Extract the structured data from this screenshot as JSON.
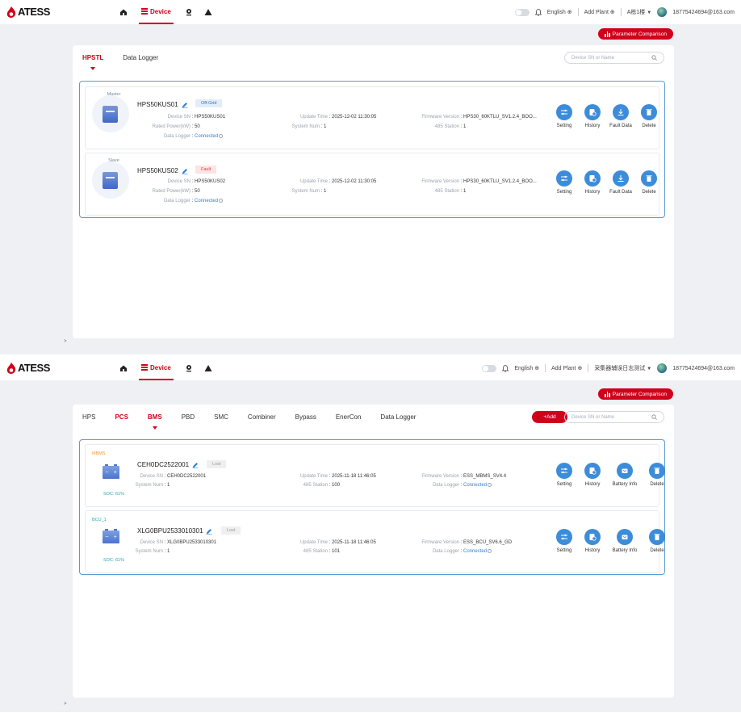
{
  "brand": {
    "logo_text": "ATESS",
    "accent": "#d0021b",
    "link": "#2f7fd6",
    "action": "#3c8cd9"
  },
  "screens": [
    {
      "nav": {
        "device_label": "Device",
        "icons": [
          "home-icon",
          "device-list-icon",
          "location-icon",
          "warning-icon"
        ]
      },
      "header": {
        "language": "English",
        "add_plant": "Add Plant",
        "plant": "A栋1楼",
        "user": "18775424694@163.com"
      },
      "param_button": "Parameter Comparison",
      "tabs": [
        {
          "label": "HPSTL",
          "active": true,
          "red": true
        },
        {
          "label": "Data Logger",
          "active": false,
          "red": false
        }
      ],
      "search_placeholder": "Device SN or Name",
      "devices": [
        {
          "role": "Master",
          "name": "HPS50KUS01",
          "status": "Off-Grid",
          "status_type": "offgrid",
          "rows": [
            {
              "k": "Device SN",
              "v": "HPS50KUS01"
            },
            {
              "k": "Rated Power(kW)",
              "v": "50"
            },
            {
              "k": "Data Logger",
              "v": "Connected",
              "link": true,
              "info": true
            }
          ],
          "mid": [
            {
              "k": "Update Time",
              "v": "2025-12-02 11:30:05"
            },
            {
              "k": "System Num",
              "v": "1"
            }
          ],
          "right": [
            {
              "k": "Firmware Version",
              "v": "HPS30_60KTLU_SV1.2.4_BOO..."
            },
            {
              "k": "485 Station",
              "v": "1"
            }
          ],
          "actions": [
            {
              "label": "Setting",
              "icon": "sliders-icon"
            },
            {
              "label": "History",
              "icon": "history-icon"
            },
            {
              "label": "Fault Data",
              "icon": "download-icon"
            },
            {
              "label": "Delete",
              "icon": "trash-icon"
            }
          ]
        },
        {
          "role": "Slave",
          "name": "HPS50KUS02",
          "status": "Fault",
          "status_type": "fault",
          "rows": [
            {
              "k": "Device SN",
              "v": "HPS50KUS02"
            },
            {
              "k": "Rated Power(kW)",
              "v": "50"
            },
            {
              "k": "Data Logger",
              "v": "Connected",
              "link": true,
              "info": true
            }
          ],
          "mid": [
            {
              "k": "Update Time",
              "v": "2025-12-02 11:30:05"
            },
            {
              "k": "System Num",
              "v": "1"
            }
          ],
          "right": [
            {
              "k": "Firmware Version",
              "v": "HPS30_60KTLU_SV1.2.4_BOO..."
            },
            {
              "k": "485 Station",
              "v": "1"
            }
          ],
          "actions": [
            {
              "label": "Setting",
              "icon": "sliders-icon"
            },
            {
              "label": "History",
              "icon": "history-icon"
            },
            {
              "label": "Fault Data",
              "icon": "download-icon"
            },
            {
              "label": "Delete",
              "icon": "trash-icon"
            }
          ]
        }
      ]
    },
    {
      "nav": {
        "device_label": "Device",
        "icons": [
          "home-icon",
          "device-list-icon",
          "location-icon",
          "warning-icon"
        ]
      },
      "header": {
        "language": "English",
        "add_plant": "Add Plant",
        "plant": "采集器辅误日志测试",
        "user": "18775424694@163.com"
      },
      "param_button": "Parameter Comparison",
      "tabs": [
        {
          "label": "HPS",
          "active": false,
          "red": false
        },
        {
          "label": "PCS",
          "active": false,
          "red": true
        },
        {
          "label": "BMS",
          "active": true,
          "red": true
        },
        {
          "label": "PBD",
          "active": false,
          "red": false
        },
        {
          "label": "SMC",
          "active": false,
          "red": false
        },
        {
          "label": "Combiner",
          "active": false,
          "red": false
        },
        {
          "label": "Bypass",
          "active": false,
          "red": false
        },
        {
          "label": "EnerCon",
          "active": false,
          "red": false
        },
        {
          "label": "Data Logger",
          "active": false,
          "red": false
        }
      ],
      "add_label": "+Add",
      "search_placeholder": "Device SN or Name",
      "devices": [
        {
          "role": "MBMS",
          "role_color": "orange",
          "soc": "SOC: 61%",
          "name": "CEH0DC2522001",
          "status": "Lost",
          "status_type": "lost",
          "rows": [
            {
              "k": "Device SN",
              "v": "CEH0DC2522001"
            },
            {
              "k": "System Num",
              "v": "1"
            }
          ],
          "mid": [
            {
              "k": "Update Time",
              "v": "2025-11-18 11:46:05"
            },
            {
              "k": "485 Station",
              "v": "100"
            }
          ],
          "right": [
            {
              "k": "Firmware Version",
              "v": "ESS_MBMS_SV4.4"
            },
            {
              "k": "Data Logger",
              "v": "Connected",
              "link": true,
              "info": true
            }
          ],
          "actions": [
            {
              "label": "Setting",
              "icon": "sliders-icon"
            },
            {
              "label": "History",
              "icon": "history-icon"
            },
            {
              "label": "Battery Info",
              "icon": "battery-info-icon"
            },
            {
              "label": "Delete",
              "icon": "trash-icon"
            }
          ]
        },
        {
          "role": "BCU_1",
          "role_color": "teal",
          "soc": "SOC: 61%",
          "name": "XLG0BPU2533010301",
          "status": "Lost",
          "status_type": "lost",
          "rows": [
            {
              "k": "Device SN",
              "v": "XLG0BPU2533010301"
            },
            {
              "k": "System Num",
              "v": "1"
            }
          ],
          "mid": [
            {
              "k": "Update Time",
              "v": "2025-11-18 11:46:05"
            },
            {
              "k": "485 Station",
              "v": "101"
            }
          ],
          "right": [
            {
              "k": "Firmware Version",
              "v": "ESS_BCU_SV6.6_GD"
            },
            {
              "k": "Data Logger",
              "v": "Connected",
              "link": true,
              "info": true
            }
          ],
          "actions": [
            {
              "label": "Setting",
              "icon": "sliders-icon"
            },
            {
              "label": "History",
              "icon": "history-icon"
            },
            {
              "label": "Battery Info",
              "icon": "battery-info-icon"
            },
            {
              "label": "Delete",
              "icon": "trash-icon"
            }
          ]
        }
      ]
    }
  ],
  "side_caret": ">"
}
